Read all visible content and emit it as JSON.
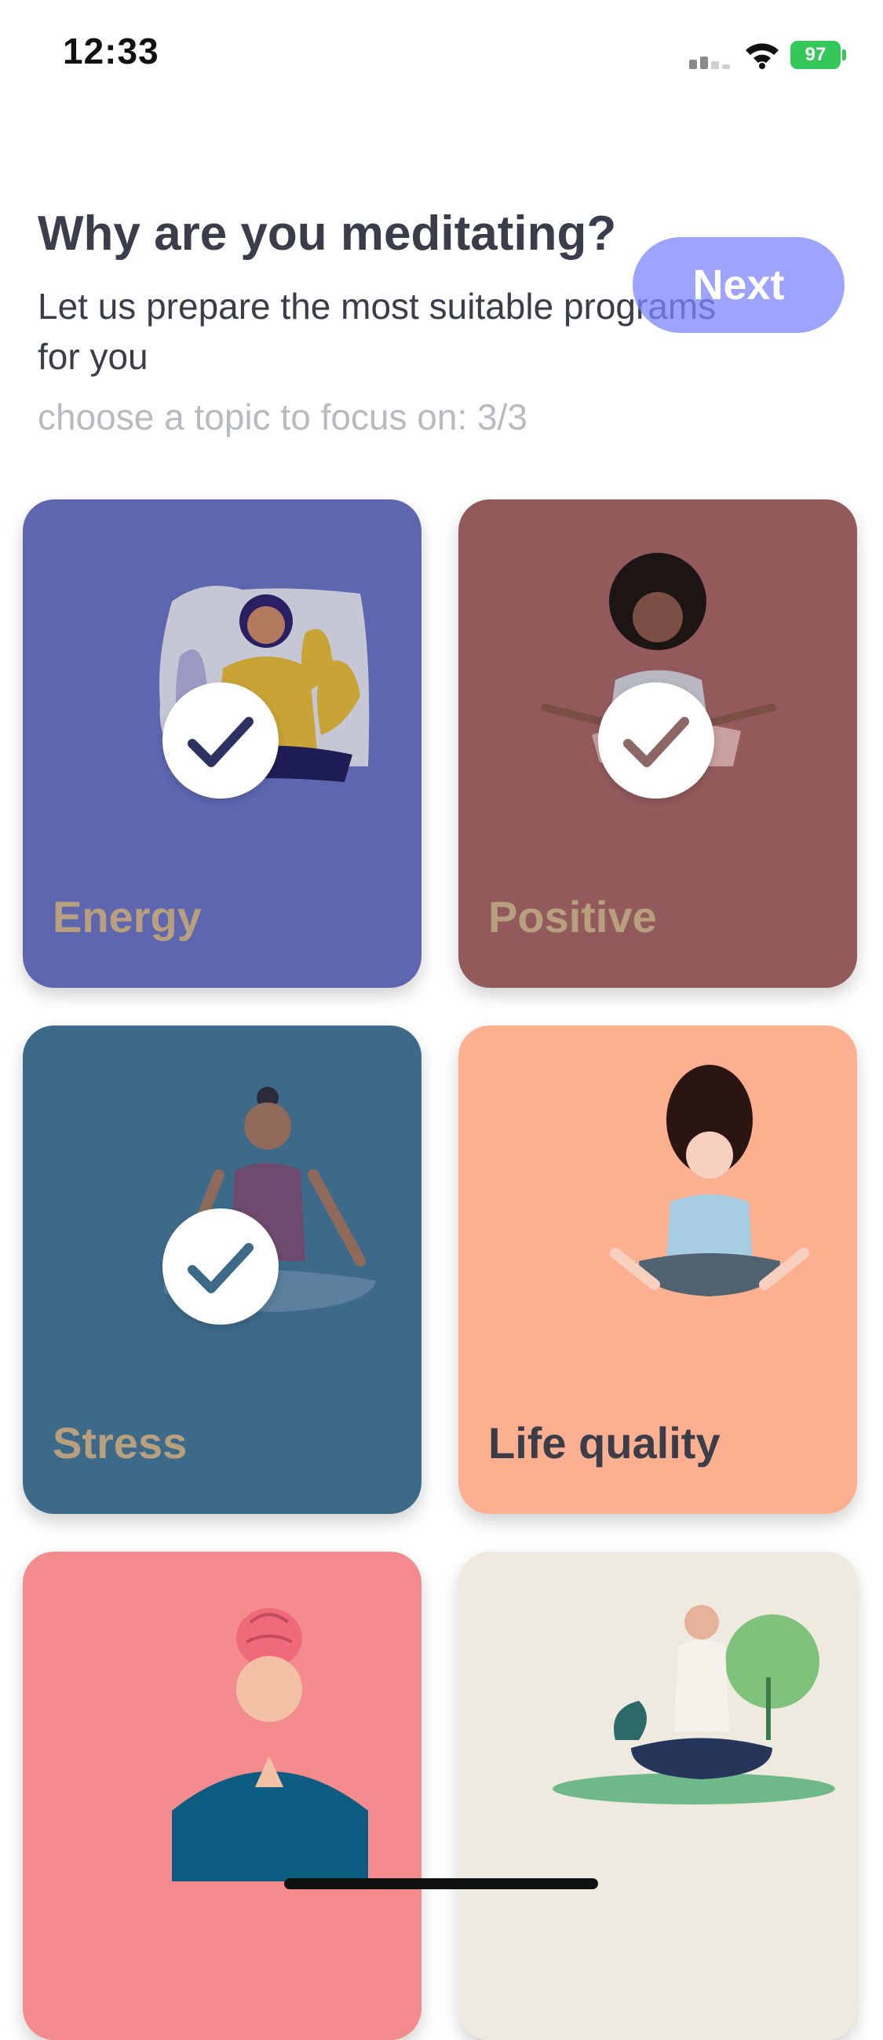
{
  "status_bar": {
    "time": "12:33",
    "battery": "97"
  },
  "header": {
    "title": "Why are you meditating?",
    "subtitle": "Let us prepare the most suitable programs for you",
    "progress": "choose a topic to focus on: 3/3",
    "next_label": "Next"
  },
  "cards": [
    {
      "label": "Energy",
      "selected": true
    },
    {
      "label": "Positive",
      "selected": true
    },
    {
      "label": "Stress",
      "selected": true
    },
    {
      "label": "Life quality",
      "selected": false
    },
    {
      "label": "",
      "selected": false
    },
    {
      "label": "",
      "selected": false
    }
  ],
  "colors": {
    "energy": "#5f66b0",
    "positive": "#935a5c",
    "stress": "#3e6a8a",
    "life_quality": "#fcb08f",
    "mind": "#f48b8f",
    "nature": "#efeae0",
    "selected_label": "#b8a07e",
    "next_button": "#9aa2ff"
  },
  "icons": [
    "check-icon",
    "wifi-icon",
    "signal-icon",
    "battery-icon"
  ]
}
